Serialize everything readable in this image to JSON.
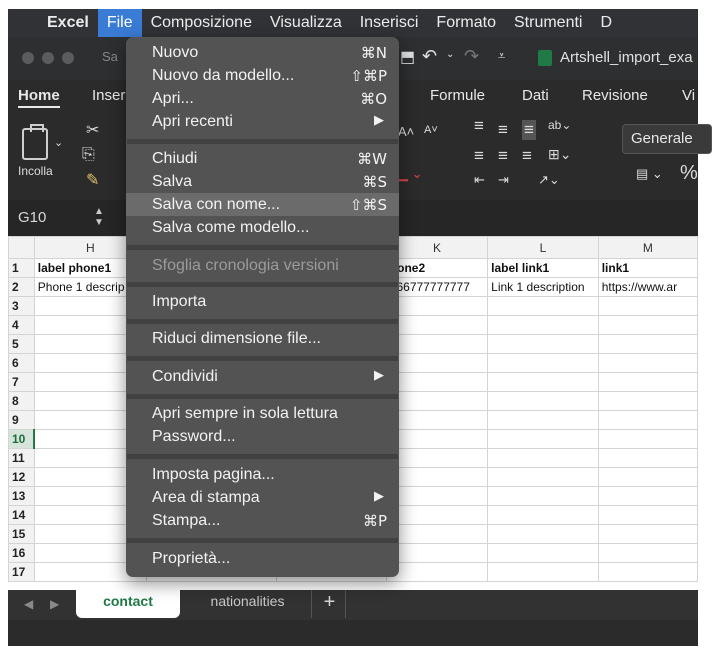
{
  "menubar": {
    "apple": "",
    "app": "Excel",
    "items": [
      "File",
      "Composizione",
      "Visualizza",
      "Inserisci",
      "Formato",
      "Strumenti",
      "D"
    ]
  },
  "titlebar": {
    "left_text": "Sa",
    "filename": "Artshell_import_exa",
    "undo_icon": "↶",
    "redo_icon": "↷",
    "save_glyph": "⬒"
  },
  "ribbon_tabs": {
    "home": "Home",
    "insert": "Inser",
    "formulas": "Formule",
    "data": "Dati",
    "review": "Revisione",
    "view": "Vi"
  },
  "ribbon": {
    "paste_label": "Incolla",
    "number_format": "Generale",
    "percent": "%"
  },
  "formulabar": {
    "cell_ref": "G10"
  },
  "sheet": {
    "columns": [
      {
        "label": "",
        "width": 26
      },
      {
        "label": "H",
        "width": 113
      },
      {
        "label": "",
        "width": 136
      },
      {
        "label": "",
        "width": 114
      },
      {
        "label": "K",
        "width": 102
      },
      {
        "label": "L",
        "width": 111
      },
      {
        "label": "M",
        "width": 100
      }
    ],
    "rows": [
      [
        "1",
        "label phone1",
        "",
        "",
        "hone2",
        "label link1",
        "link1"
      ],
      [
        "2",
        "Phone 1 descrip",
        "",
        "",
        "566777777777",
        "Link 1 description",
        "https://www.ar"
      ],
      [
        "3",
        "",
        "",
        "",
        "",
        "",
        ""
      ],
      [
        "4",
        "",
        "",
        "",
        "",
        "",
        ""
      ],
      [
        "5",
        "",
        "",
        "",
        "",
        "",
        ""
      ],
      [
        "6",
        "",
        "",
        "",
        "",
        "",
        ""
      ],
      [
        "7",
        "",
        "",
        "",
        "",
        "",
        ""
      ],
      [
        "8",
        "",
        "",
        "",
        "",
        "",
        ""
      ],
      [
        "9",
        "",
        "",
        "",
        "",
        "",
        ""
      ],
      [
        "10",
        "",
        "",
        "",
        "",
        "",
        ""
      ],
      [
        "11",
        "",
        "",
        "",
        "",
        "",
        ""
      ],
      [
        "12",
        "",
        "",
        "",
        "",
        "",
        ""
      ],
      [
        "13",
        "",
        "",
        "",
        "",
        "",
        ""
      ],
      [
        "14",
        "",
        "",
        "",
        "",
        "",
        ""
      ],
      [
        "15",
        "",
        "",
        "",
        "",
        "",
        ""
      ],
      [
        "16",
        "",
        "",
        "",
        "",
        "",
        ""
      ],
      [
        "17",
        "",
        "",
        "",
        "",
        "",
        ""
      ]
    ],
    "selected_row": "10"
  },
  "sheet_tabs": {
    "active": "contact",
    "other": "nationalities",
    "add": "+"
  },
  "file_menu": {
    "new": {
      "label": "Nuovo",
      "shortcut": "⌘N"
    },
    "new_template": {
      "label": "Nuovo da modello...",
      "shortcut": "⇧⌘P"
    },
    "open": {
      "label": "Apri...",
      "shortcut": "⌘O"
    },
    "recent": {
      "label": "Apri recenti",
      "arrow": "▶"
    },
    "close": {
      "label": "Chiudi",
      "shortcut": "⌘W"
    },
    "save": {
      "label": "Salva",
      "shortcut": "⌘S"
    },
    "save_as": {
      "label": "Salva con nome...",
      "shortcut": "⇧⌘S"
    },
    "save_template": {
      "label": "Salva come modello..."
    },
    "history": {
      "label": "Sfoglia cronologia versioni"
    },
    "import": {
      "label": "Importa"
    },
    "reduce": {
      "label": "Riduci dimensione file..."
    },
    "share": {
      "label": "Condividi",
      "arrow": "▶"
    },
    "readonly": {
      "label": "Apri sempre in sola lettura"
    },
    "password": {
      "label": "Password..."
    },
    "page_setup": {
      "label": "Imposta pagina..."
    },
    "print_area": {
      "label": "Area di stampa",
      "arrow": "▶"
    },
    "print": {
      "label": "Stampa...",
      "shortcut": "⌘P"
    },
    "properties": {
      "label": "Proprietà..."
    }
  },
  "colors": {
    "menu_highlight": "#3a7bd5",
    "excel_green": "#1e7a45"
  }
}
